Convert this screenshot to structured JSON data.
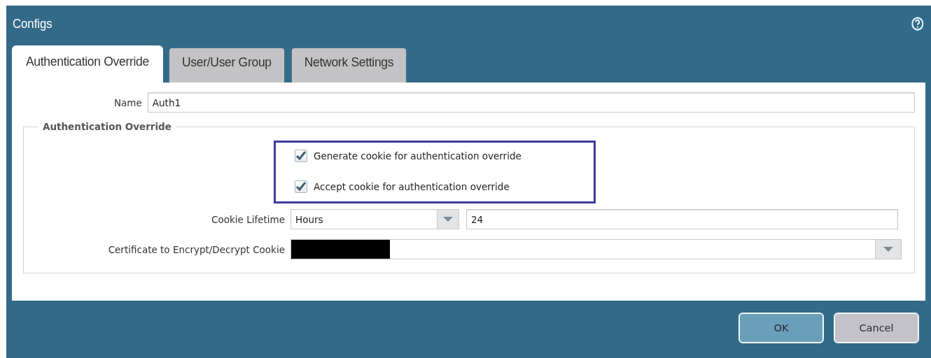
{
  "window": {
    "title": "Configs"
  },
  "tabs": [
    {
      "label": "Authentication Override",
      "selected": true
    },
    {
      "label": "User/User Group",
      "selected": false
    },
    {
      "label": "Network Settings",
      "selected": false
    }
  ],
  "name_field": {
    "label": "Name",
    "value": "Auth1"
  },
  "group": {
    "legend": "Authentication Override",
    "checkboxes": [
      {
        "label": "Generate cookie for authentication override",
        "checked": true
      },
      {
        "label": "Accept cookie for authentication override",
        "checked": true
      }
    ],
    "checkboxes_highlighted": true,
    "cookie_lifetime": {
      "label": "Cookie Lifetime",
      "unit": "Hours",
      "value": "24"
    },
    "certificate": {
      "label": "Certificate to Encrypt/Decrypt Cookie",
      "redacted": true
    }
  },
  "buttons": [
    {
      "label": "OK",
      "kind": "primary"
    },
    {
      "label": "Cancel",
      "kind": "secondary"
    }
  ]
}
